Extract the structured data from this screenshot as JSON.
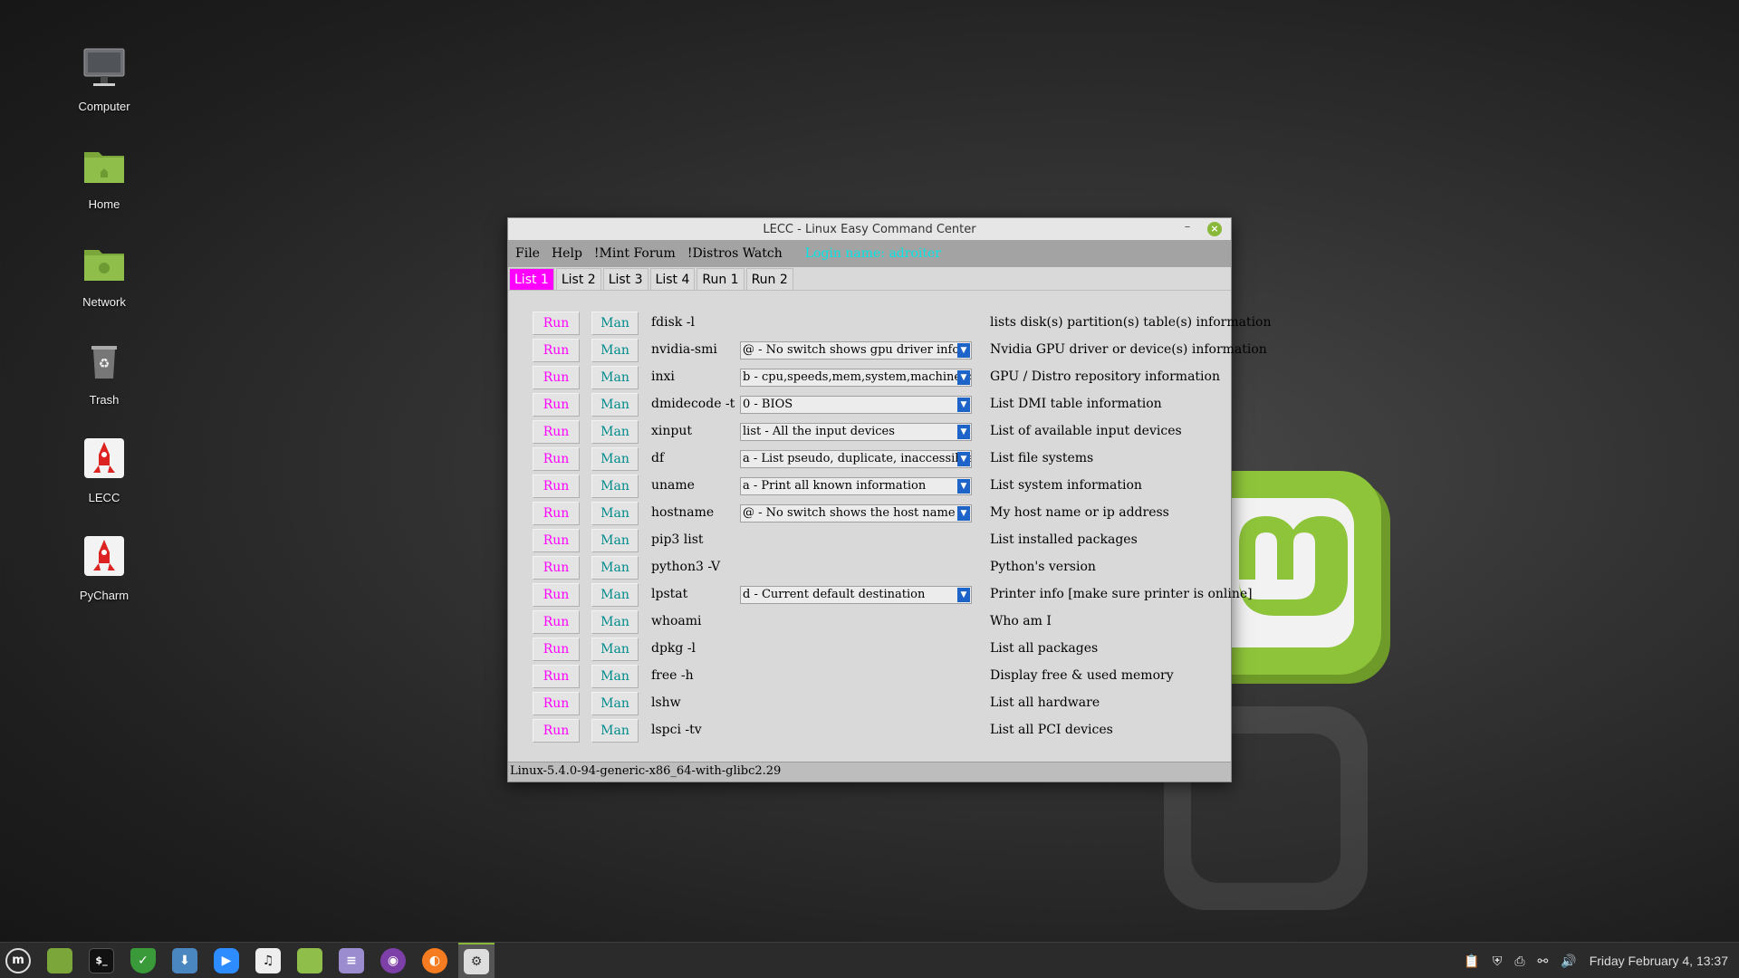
{
  "desktop": {
    "icons": [
      {
        "label": "Computer",
        "icon": "computer-icon"
      },
      {
        "label": "Home",
        "icon": "home-folder-icon"
      },
      {
        "label": "Network",
        "icon": "network-folder-icon"
      },
      {
        "label": "Trash",
        "icon": "trash-icon"
      },
      {
        "label": "LECC",
        "icon": "rocket-icon"
      },
      {
        "label": "PyCharm",
        "icon": "rocket-icon"
      }
    ]
  },
  "window": {
    "title": "LECC - Linux Easy Command Center",
    "menu": [
      "File",
      "Help",
      "!Mint Forum",
      "!Distros Watch"
    ],
    "login": "Login name: adroiter",
    "tabs": [
      "List 1",
      "List 2",
      "List 3",
      "List 4",
      "Run 1",
      "Run 2"
    ],
    "active_tab": "List 1",
    "run_label": "Run",
    "man_label": "Man",
    "rows": [
      {
        "cmd": "fdisk -l",
        "option": "",
        "desc": "lists disk(s) partition(s) table(s) information"
      },
      {
        "cmd": "nvidia-smi",
        "option": "@ - No switch shows gpu driver info",
        "desc": "Nvidia GPU driver or device(s) information"
      },
      {
        "cmd": "inxi",
        "option": "b - cpu,speeds,mem,system,machine,cpu",
        "desc": "GPU / Distro repository information"
      },
      {
        "cmd": "dmidecode -t",
        "option": "0 - BIOS",
        "desc": "List DMI table information"
      },
      {
        "cmd": "xinput",
        "option": "list - All the input devices",
        "desc": "List of available input devices"
      },
      {
        "cmd": "df",
        "option": "a - List pseudo, duplicate, inaccessible",
        "desc": "List file systems"
      },
      {
        "cmd": "uname",
        "option": "a - Print all known information",
        "desc": "List system information"
      },
      {
        "cmd": "hostname",
        "option": "@ - No switch shows the host name",
        "desc": "My host name or ip address"
      },
      {
        "cmd": "pip3 list",
        "option": "",
        "desc": "List installed packages"
      },
      {
        "cmd": "python3 -V",
        "option": "",
        "desc": "Python's version"
      },
      {
        "cmd": "lpstat",
        "option": "d - Current default destination",
        "desc": "Printer info [make sure printer is online]"
      },
      {
        "cmd": "whoami",
        "option": "",
        "desc": "Who am I"
      },
      {
        "cmd": "dpkg -l",
        "option": "",
        "desc": "List all packages"
      },
      {
        "cmd": "free -h",
        "option": "",
        "desc": "Display free & used memory"
      },
      {
        "cmd": "lshw",
        "option": "",
        "desc": "List all hardware"
      },
      {
        "cmd": "lspci -tv",
        "option": "",
        "desc": "List all PCI devices"
      }
    ],
    "status": "Linux-5.4.0-94-generic-x86_64-with-glibc2.29"
  },
  "taskbar": {
    "apps": [
      "mint-menu-icon",
      "files-icon",
      "terminal-icon",
      "shield-icon",
      "software-icon",
      "zoom-icon",
      "music-icon",
      "folder-icon",
      "text-editor-icon",
      "tor-icon",
      "firefox-icon",
      "settings-icon"
    ],
    "active_app": "settings-icon",
    "tray_icons": [
      "clipboard-icon",
      "shield-icon",
      "printer-icon",
      "network-icon",
      "volume-icon"
    ],
    "clock": "Friday February  4, 13:37"
  },
  "colors": {
    "run": "#ff00ff",
    "man": "#008b8b",
    "active_tab": "#ff00ff",
    "login": "#00e5e5",
    "combo_arrow": "#1e63c8",
    "mint_green": "#8ab83a"
  }
}
